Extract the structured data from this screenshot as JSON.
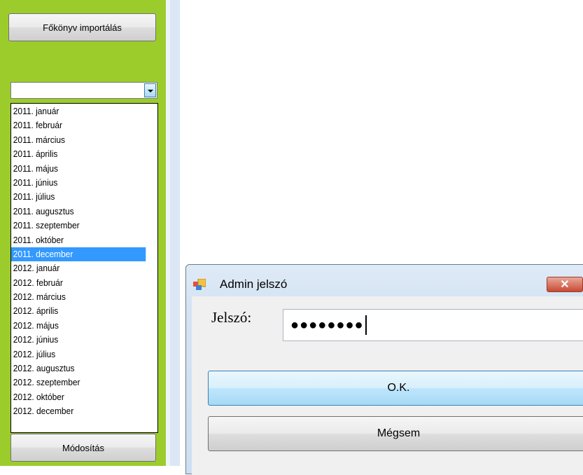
{
  "left_panel": {
    "import_button_label": "Főkönyv importálás",
    "modify_button_label": "Módosítás",
    "combo_value": "",
    "dropdown_items": [
      "2011. január",
      "2011. február",
      "2011. március",
      "2011. április",
      "2011. május",
      "2011. június",
      "2011. július",
      "2011. augusztus",
      "2011. szeptember",
      "2011. október",
      "2011. december",
      "2012. január",
      "2012. február",
      "2012. március",
      "2012. április",
      "2012. május",
      "2012. június",
      "2012. július",
      "2012. augusztus",
      "2012. szeptember",
      "2012. október",
      "2012. december"
    ],
    "selected_item": "2011. december",
    "colors": {
      "panel": "#9ccc2c",
      "selection": "#3399ff"
    }
  },
  "dialog": {
    "title": "Admin jelszó",
    "close_symbol": "✕",
    "password_label": "Jelszó:",
    "password_value": "●●●●●●●●",
    "ok_label": "O.K.",
    "cancel_label": "Mégsem"
  }
}
